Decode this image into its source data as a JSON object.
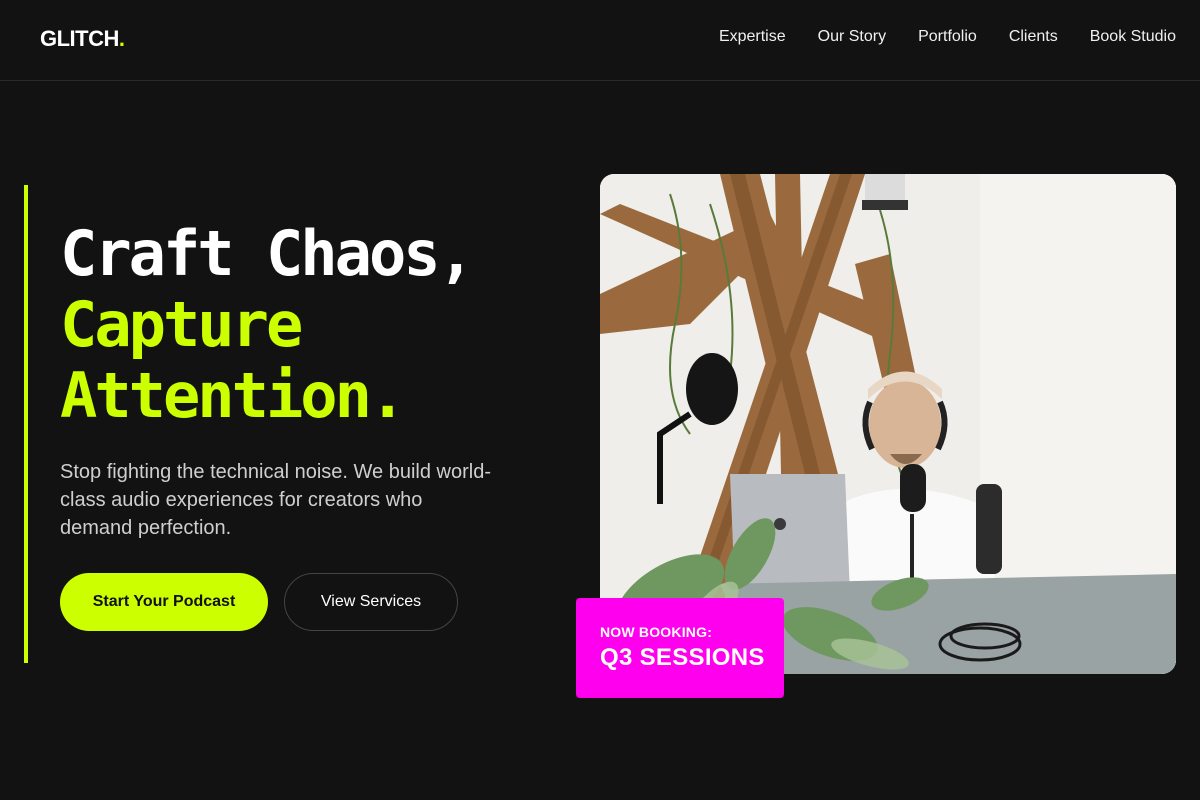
{
  "brand": {
    "name": "GLITCH",
    "dot": ".",
    "accent_color": "#ccff00",
    "highlight_color": "#ff00ee"
  },
  "nav": {
    "items": [
      {
        "label": "Expertise"
      },
      {
        "label": "Our Story"
      },
      {
        "label": "Portfolio"
      },
      {
        "label": "Clients"
      },
      {
        "label": "Book Studio"
      }
    ]
  },
  "hero": {
    "headline_line1": "Craft Chaos,",
    "headline_line2": "Capture",
    "headline_line3": "Attention.",
    "subcopy": "Stop fighting the technical noise. We build world-class audio experiences for creators who demand perfection.",
    "primary_cta": "Start Your Podcast",
    "secondary_cta": "View Services",
    "image_icon": "podcast-studio-photo"
  },
  "badge": {
    "label": "NOW BOOKING:",
    "value": "Q3 SESSIONS"
  }
}
